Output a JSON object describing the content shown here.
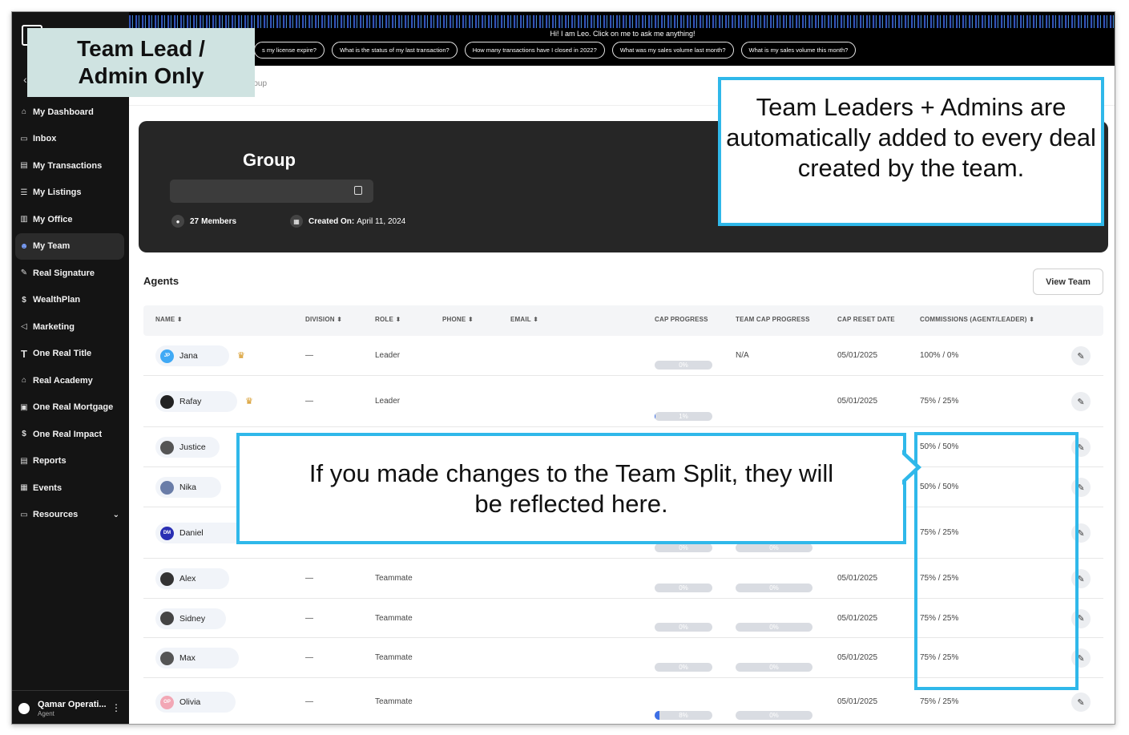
{
  "banner": {
    "greeting": "Hi! I am Leo. Click on me to ask me anything!",
    "chips": [
      "s my license expire?",
      "What is the status of my last transaction?",
      "How many transactions have I closed in 2022?",
      "What was my sales volume last month?",
      "What is my sales volume this month?"
    ]
  },
  "breadcrumb": "roup",
  "sidebar": {
    "items": [
      {
        "label": "My Dashboard",
        "icon": "home-icon"
      },
      {
        "label": "Inbox",
        "icon": "inbox-icon"
      },
      {
        "label": "My Transactions",
        "icon": "clipboard-icon"
      },
      {
        "label": "My Listings",
        "icon": "list-icon"
      },
      {
        "label": "My Office",
        "icon": "building-icon"
      },
      {
        "label": "My Team",
        "icon": "team-icon"
      },
      {
        "label": "Real Signature",
        "icon": "signature-icon"
      },
      {
        "label": "WealthPlan",
        "icon": "wealth-icon"
      },
      {
        "label": "Marketing",
        "icon": "megaphone-icon"
      },
      {
        "label": "One Real Title",
        "icon": "title-icon"
      },
      {
        "label": "Real Academy",
        "icon": "academy-icon"
      },
      {
        "label": "One Real Mortgage",
        "icon": "mortgage-icon"
      },
      {
        "label": "One Real Impact",
        "icon": "impact-icon"
      },
      {
        "label": "Reports",
        "icon": "report-icon"
      },
      {
        "label": "Events",
        "icon": "calendar-icon"
      },
      {
        "label": "Resources",
        "icon": "folder-icon"
      }
    ],
    "user_name": "Qamar Operati...",
    "user_role": "Agent"
  },
  "group": {
    "title": "Group",
    "members_count": "27",
    "members_label": "Members",
    "created_label": "Created On:",
    "created_date": "April 11, 2024"
  },
  "agents": {
    "heading": "Agents",
    "view_team": "View Team",
    "columns": [
      "NAME",
      "DIVISION",
      "ROLE",
      "PHONE",
      "EMAIL",
      "CAP PROGRESS",
      "TEAM CAP PROGRESS",
      "CAP RESET DATE",
      "COMMISSIONS (AGENT/LEADER)"
    ],
    "rows": [
      {
        "name": "Jana",
        "initials": "JP",
        "crown": true,
        "division": "—",
        "role": "Leader",
        "cap": "0%",
        "cap_pct": 0,
        "team_cap": "N/A",
        "reset": "05/01/2025",
        "commission": "100% / 0%"
      },
      {
        "name": "Rafay",
        "initials": "",
        "crown": true,
        "division": "—",
        "role": "Leader",
        "cap": "1%",
        "cap_pct": 1,
        "team_cap": "",
        "reset": "05/01/2025",
        "commission": "75% / 25%"
      },
      {
        "name": "Justice",
        "initials": "",
        "crown": false,
        "division": "",
        "role": "",
        "cap": "",
        "cap_pct": 0,
        "team_cap": "",
        "reset": "",
        "commission": "50% / 50%"
      },
      {
        "name": "Nika",
        "initials": "",
        "crown": false,
        "division": "",
        "role": "",
        "cap": "",
        "cap_pct": 0,
        "team_cap": "",
        "reset": "",
        "commission": "50% / 50%"
      },
      {
        "name": "Daniel",
        "initials": "DM",
        "crown": false,
        "division": "",
        "role": "",
        "cap": "0%",
        "cap_pct": 0,
        "team_cap": "0%",
        "reset": "",
        "commission": "75% / 25%"
      },
      {
        "name": "Alex",
        "initials": "",
        "crown": false,
        "division": "—",
        "role": "Teammate",
        "cap": "0%",
        "cap_pct": 0,
        "team_cap": "0%",
        "reset": "05/01/2025",
        "commission": "75% / 25%"
      },
      {
        "name": "Sidney",
        "initials": "",
        "crown": false,
        "division": "—",
        "role": "Teammate",
        "cap": "0%",
        "cap_pct": 0,
        "team_cap": "0%",
        "reset": "05/01/2025",
        "commission": "75% / 25%"
      },
      {
        "name": "Max",
        "initials": "",
        "crown": false,
        "division": "—",
        "role": "Teammate",
        "cap": "0%",
        "cap_pct": 0,
        "team_cap": "0%",
        "reset": "05/01/2025",
        "commission": "75% / 25%"
      },
      {
        "name": "Olivia",
        "initials": "OP",
        "crown": false,
        "division": "—",
        "role": "Teammate",
        "cap": "8%",
        "cap_pct": 8,
        "team_cap": "0%",
        "reset": "05/01/2025",
        "commission": "75% / 25%"
      }
    ]
  },
  "annotations": {
    "team_lead_line1": "Team Lead /",
    "team_lead_line2": "Admin Only",
    "top_callout": "Team Leaders + Admins are automatically added to every deal created by the team.",
    "mid_callout_line1": "If you made changes to the Team Split, they will",
    "mid_callout_line2": "be reflected here."
  },
  "colors": {
    "accent_blue": "#2fb8ea",
    "sidebar_bg": "#141414",
    "progress_fill": "#3d6fe6"
  }
}
